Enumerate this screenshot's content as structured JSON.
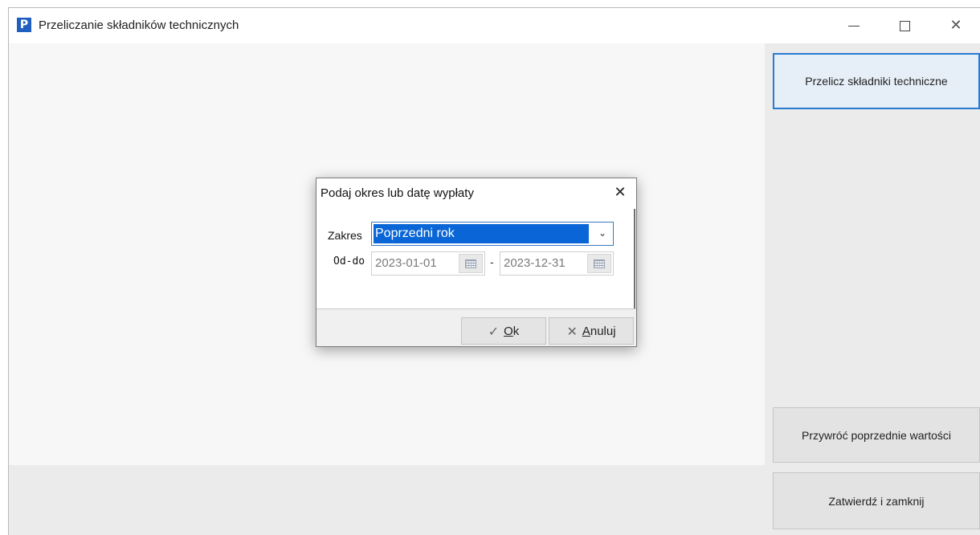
{
  "window": {
    "app_icon": "P",
    "title": "Przeliczanie składników technicznych",
    "minimize_icon": "minimize-icon",
    "maximize_icon": "maximize-icon",
    "close_glyph": "✕"
  },
  "side_buttons": {
    "recalculate": "Przelicz składniki techniczne",
    "restore": "Przywróć poprzednie wartości",
    "confirm_close": "Zatwierdź i zamknij"
  },
  "dialog": {
    "title": "Podaj okres lub datę wypłaty",
    "close_glyph": "✕",
    "zakres_label": "Zakres",
    "zakres_value": "Poprzedni rok",
    "oddo_label": "Od-do",
    "date_from": "2023-01-01",
    "date_separator": "-",
    "date_to": "2023-12-31",
    "ok_glyph": "✓",
    "ok_label": "Ok",
    "cancel_glyph": "✕",
    "cancel_label": "Anuluj",
    "ok_first": "O",
    "ok_rest": "k",
    "cancel_first": "A",
    "cancel_rest": "nuluj"
  },
  "colors": {
    "accent": "#2a7ad4",
    "selection": "#0a66d6"
  }
}
